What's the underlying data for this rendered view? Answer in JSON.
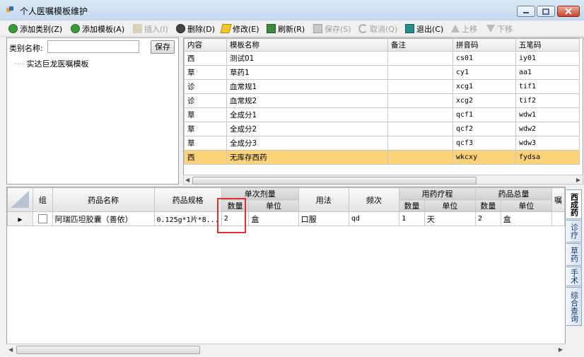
{
  "window": {
    "title": "个人医嘱模板维护"
  },
  "toolbar": {
    "items": [
      {
        "label": "添加类别(Z)",
        "icon": "add-circle-icon",
        "enabled": true
      },
      {
        "label": "添加模板(A)",
        "icon": "add-circle-icon",
        "enabled": true
      },
      {
        "label": "插入(I)",
        "icon": "edit-pencil-icon",
        "enabled": false
      },
      {
        "label": "删除(D)",
        "icon": "minus-circle-icon",
        "enabled": true
      },
      {
        "label": "修改(E)",
        "icon": "eraser-icon",
        "enabled": true
      },
      {
        "label": "刷新(R)",
        "icon": "refresh-icon",
        "enabled": true
      },
      {
        "label": "保存(S)",
        "icon": "save-disk-icon",
        "enabled": false
      },
      {
        "label": "取消(Q)",
        "icon": "undo-icon",
        "enabled": false
      },
      {
        "label": "退出(C)",
        "icon": "exit-icon",
        "enabled": true
      },
      {
        "label": "上移",
        "icon": "arrow-up-icon",
        "enabled": false
      },
      {
        "label": "下移",
        "icon": "arrow-down-icon",
        "enabled": false
      }
    ]
  },
  "left": {
    "category_label": "类别名称:",
    "category_value": "",
    "save_label": "保存",
    "tree_root": "实达巨龙医嘱模板"
  },
  "top_grid": {
    "columns": [
      "内容",
      "模板名称",
      "备注",
      "拼音码",
      "五笔码"
    ],
    "rows": [
      {
        "type": "西",
        "name": "测试01",
        "note": "",
        "pinyin": "cs01",
        "wubi": "iy01"
      },
      {
        "type": "草",
        "name": "草药1",
        "note": "",
        "pinyin": "cy1",
        "wubi": "aa1"
      },
      {
        "type": "诊",
        "name": "血常规1",
        "note": "",
        "pinyin": "xcg1",
        "wubi": "tif1"
      },
      {
        "type": "诊",
        "name": "血常规2",
        "note": "",
        "pinyin": "xcg2",
        "wubi": "tif2"
      },
      {
        "type": "草",
        "name": "全成分1",
        "note": "",
        "pinyin": "qcf1",
        "wubi": "wdw1"
      },
      {
        "type": "草",
        "name": "全成分2",
        "note": "",
        "pinyin": "qcf2",
        "wubi": "wdw2"
      },
      {
        "type": "草",
        "name": "全成分3",
        "note": "",
        "pinyin": "qcf3",
        "wubi": "wdw3"
      },
      {
        "type": "西",
        "name": "无库存西药",
        "note": "",
        "pinyin": "wkcxy",
        "wubi": "fydsa",
        "selected": true
      }
    ]
  },
  "bottom_grid": {
    "headers": {
      "group": "组",
      "drug_name": "药品名称",
      "spec": "药品规格",
      "single_dose": "单次剂量",
      "usage": "用法",
      "freq": "频次",
      "course": "用药疗程",
      "total": "药品总量",
      "extra": "嘱",
      "qty": "数量",
      "unit": "单位"
    },
    "rows": [
      {
        "name": "阿瑞匹坦胶囊（善依）",
        "spec": "0.125g*1片*8...",
        "dose_qty": "2",
        "dose_unit": "盒",
        "usage": "口服",
        "freq": "qd",
        "course_qty": "1",
        "course_unit": "天",
        "total_qty": "2",
        "total_unit": "盒"
      }
    ]
  },
  "side_tabs": [
    "西成药",
    "诊疗",
    "草药",
    "手术",
    "综合查询"
  ]
}
